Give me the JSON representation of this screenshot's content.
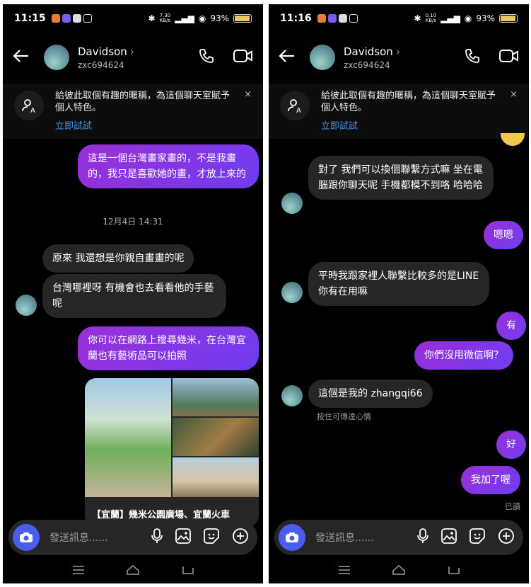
{
  "left": {
    "status": {
      "time": "11:15",
      "speed_top": "7.30",
      "speed_bot": "KB/s",
      "battery": "93%"
    },
    "header": {
      "name": "Davidson",
      "chevron": "›",
      "username": "zxc694624"
    },
    "tip": {
      "text": "給彼此取個有趣的暱稱，為這個聊天室賦予個人特色。",
      "link": "立即試試",
      "close": "×"
    },
    "messages": {
      "m1": "這是一個台灣畫家畫的，不是我畫的，我只是喜歡她的畫，才放上來的",
      "timestamp": "12月4日 14:31",
      "m2": "原來 我還想是你親自畫畫的呢",
      "m3": "台灣哪裡呀 有機會也去看看他的手藝呢",
      "m4": "你可以在網路上搜尋幾米，在台灣宜蘭也有藝術品可以拍照",
      "card_title": "【宜蘭】幾米公園廣場、宜蘭火車"
    },
    "composer": {
      "placeholder": "發送訊息......"
    }
  },
  "right": {
    "status": {
      "time": "11:16",
      "speed_top": "0.10",
      "speed_bot": "KB/s",
      "battery": "93%"
    },
    "header": {
      "name": "Davidson",
      "chevron": "›",
      "username": "zxc694624"
    },
    "tip": {
      "text": "給彼此取個有趣的暱稱，為這個聊天室賦予個人特色。",
      "link": "立即試試",
      "close": "×"
    },
    "messages": {
      "m1": "對了 我們可以換個聯繫方式嘛 坐在電腦跟你聊天呢 手機都模不到咯 哈哈哈",
      "m2": "嗯嗯",
      "m3": "平時我跟家裡人聯繫比較多的是LINE 你有在用嘛",
      "m4": "有",
      "m5": "你們沒用微信啊？",
      "m6": "這個是我的 zhangqi66",
      "hint": "按住可傳達心情",
      "m7": "好",
      "m8": "我加了喔",
      "seen": "已讀"
    },
    "composer": {
      "placeholder": "發送訊息......"
    }
  },
  "colors": {
    "sent_from": "#9a2fd8",
    "sent_to": "#6f3df0",
    "received": "#262626",
    "link": "#4a90e2",
    "camera": "#4a5df0"
  },
  "icons": [
    "back-arrow-icon",
    "phone-icon",
    "video-icon",
    "add-person-icon",
    "camera-icon",
    "microphone-icon",
    "gallery-icon",
    "sticker-icon",
    "plus-circle-icon",
    "menu-nav-icon",
    "home-nav-icon",
    "back-nav-icon"
  ]
}
